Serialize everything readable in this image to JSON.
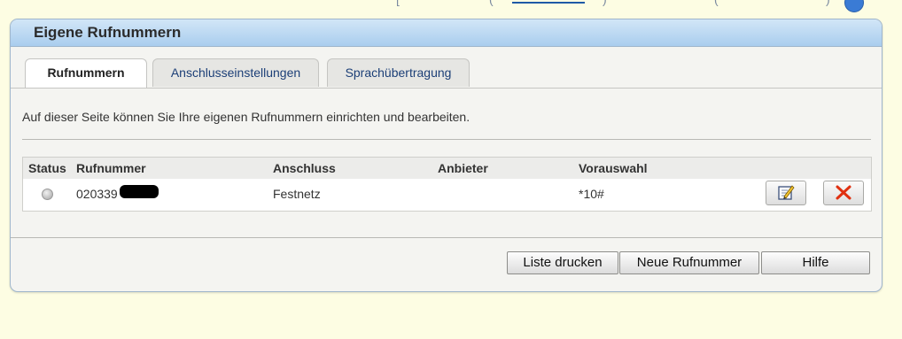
{
  "top_strip": {
    "fragments": [
      "[",
      ",",
      "(",
      ")",
      "(",
      ")",
      ","
    ]
  },
  "panel": {
    "title": "Eigene Rufnummern",
    "tabs": [
      {
        "label": "Rufnummern",
        "active": true
      },
      {
        "label": "Anschlusseinstellungen",
        "active": false
      },
      {
        "label": "Sprachübertragung",
        "active": false
      }
    ],
    "intro": "Auf dieser Seite können Sie Ihre eigenen Rufnummern einrichten und bearbeiten.",
    "table": {
      "headers": {
        "status": "Status",
        "number": "Rufnummer",
        "connection": "Anschluss",
        "provider": "Anbieter",
        "preselection": "Vorauswahl"
      },
      "rows": [
        {
          "status": "inactive",
          "number": "020339",
          "connection": "Festnetz",
          "provider": "",
          "preselection": "*10#",
          "edit_icon": "edit-icon",
          "delete_icon": "delete-x-icon"
        }
      ]
    },
    "buttons": {
      "print": "Liste drucken",
      "new": "Neue Rufnummer",
      "help": "Hilfe"
    }
  },
  "colors": {
    "background": "#fdfde3",
    "header_blue": "#a9cdee",
    "tab_text": "#1c3f77",
    "delete_red": "#e03010"
  }
}
